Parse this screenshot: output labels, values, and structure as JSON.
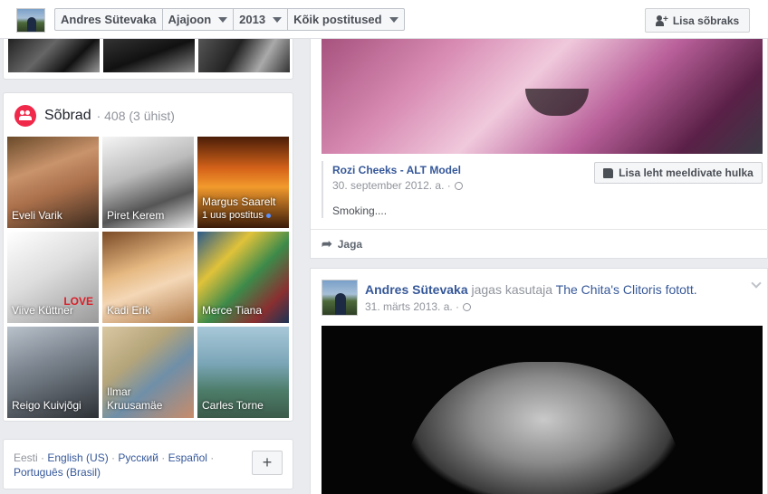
{
  "topbar": {
    "crumbs": [
      {
        "label": "Andres Sütevaka",
        "dropdown": false
      },
      {
        "label": "Ajajoon",
        "dropdown": true
      },
      {
        "label": "2013",
        "dropdown": true
      },
      {
        "label": "Kõik postitused",
        "dropdown": true
      }
    ],
    "add_friend_label": "Lisa sõbraks"
  },
  "friends": {
    "title": "Sõbrad",
    "count": "· 408 (3 ühist)",
    "tiles": [
      {
        "name": "Eveli Varik"
      },
      {
        "name": "Piret Kerem"
      },
      {
        "name": "Margus Saarelt",
        "sub": "1 uus postitus"
      },
      {
        "name": "Viive Küttner",
        "overlay": "LOVE"
      },
      {
        "name": "Kadi Erik"
      },
      {
        "name": "Merce Tiana"
      },
      {
        "name": "Reigo Kuivjõgi"
      },
      {
        "name": "Ilmar Kruusamäe"
      },
      {
        "name": "Carles Torne"
      }
    ]
  },
  "languages": {
    "current": "Eesti",
    "links": [
      "English (US)",
      "Русский",
      "Español",
      "Português (Brasil)"
    ],
    "add_label": "+"
  },
  "post1": {
    "page_name": "Rozi Cheeks - ALT Model",
    "date": "30. september 2012. a. ·",
    "body": "Smoking....",
    "like_page_label": "Lisa leht meeldivate hulka",
    "share_label": "Jaga"
  },
  "post2": {
    "author": "Andres Sütevaka",
    "action": "jagas kasutaja",
    "target": "The Chita's Clitoris fotott.",
    "date": "31. märts 2013. a. ·"
  },
  "colors": {
    "link": "#365899",
    "friends_icon": "#f02849",
    "background": "#e9ebee"
  }
}
